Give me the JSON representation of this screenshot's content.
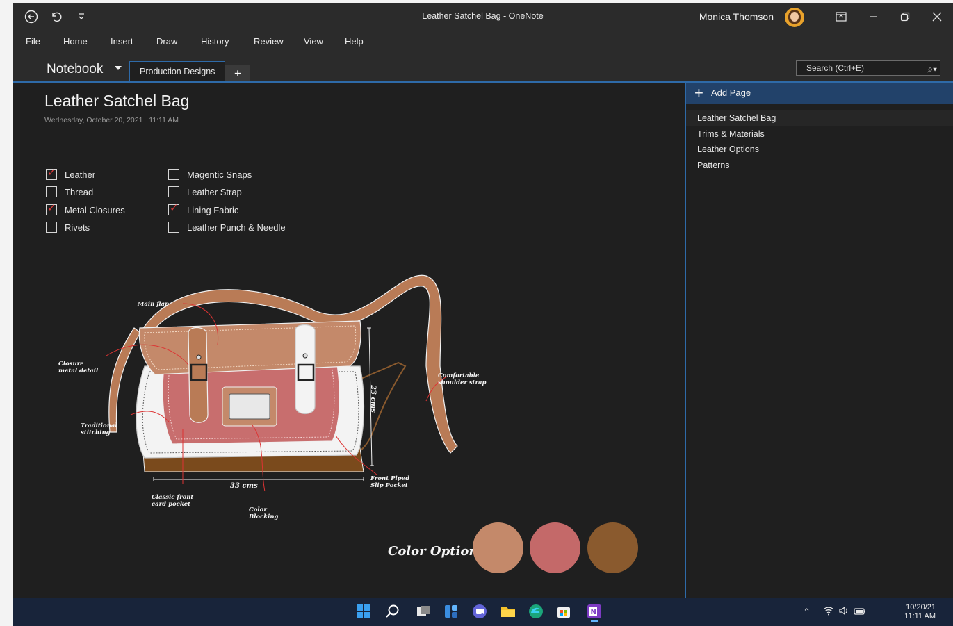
{
  "window": {
    "title": "Leather Satchel Bag - OneNote",
    "user_name": "Monica Thomson"
  },
  "menu": [
    "File",
    "Home",
    "Insert",
    "Draw",
    "History",
    "Review",
    "View",
    "Help"
  ],
  "notebook": {
    "name": "Notebook",
    "section_tab": "Production Designs",
    "add_tab": "+"
  },
  "search": {
    "placeholder": "Search (Ctrl+E)"
  },
  "page": {
    "title": "Leather Satchel Bag",
    "date": "Wednesday, October 20, 2021",
    "time": "11:11 AM"
  },
  "checklist": [
    {
      "label": "Leather",
      "checked": true
    },
    {
      "label": "Thread",
      "checked": false
    },
    {
      "label": "Metal Closures",
      "checked": true
    },
    {
      "label": "Rivets",
      "checked": false
    },
    {
      "label": "Magentic Snaps",
      "checked": false
    },
    {
      "label": "Leather Strap",
      "checked": false
    },
    {
      "label": "Lining Fabric",
      "checked": true
    },
    {
      "label": "Leather Punch & Needle",
      "checked": false
    }
  ],
  "sketch": {
    "annotations": {
      "main_flap": "Main flap",
      "closure_1": "Closure",
      "closure_2": "metal detail",
      "stitching_1": "Traditional",
      "stitching_2": "stitching",
      "strap_1": "Comfortable",
      "strap_2": "shoulder strap",
      "front_pocket_1": "Front Piped",
      "front_pocket_2": "Slip Pocket",
      "card_pocket_1": "Classic front",
      "card_pocket_2": "card pocket",
      "color_blocking_1": "Color",
      "color_blocking_2": "Blocking",
      "height": "23 cms",
      "width": "33 cms"
    },
    "color_options_label": "Color Options",
    "color_swatches": [
      "#c4896a",
      "#c46969",
      "#8a5a2e"
    ]
  },
  "pages_pane": {
    "add_page_label": "Add Page",
    "pages": [
      "Leather Satchel Bag",
      "Trims & Materials",
      "Leather Options",
      "Patterns"
    ]
  },
  "taskbar": {
    "date": "10/20/21",
    "time": "11:11 AM"
  }
}
